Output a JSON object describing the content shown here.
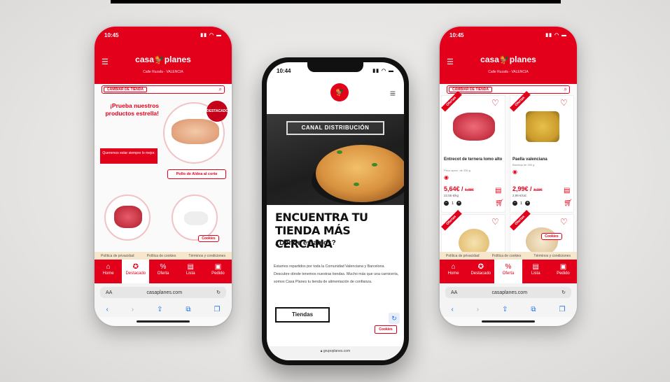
{
  "left": {
    "time": "10:45",
    "logo": "casa🐓planes",
    "location": "Calle Ruzafa - VALENCIA",
    "change_store": "CAMBIAR DE TIENDA",
    "promo_title": "¡Prueba nuestros productos estrella!",
    "promo_cta": "Queremos estar siempre lo mejor.",
    "badge": "DESTACADO",
    "product_button": "Pollo de Aldea al corte",
    "cookies": "Cookies",
    "cookie_links": [
      "Política de privacidad",
      "Política de cookies",
      "Términos y condiciones"
    ],
    "tabs": [
      "Home",
      "Destacado",
      "Oferta",
      "Lista",
      "Pedido"
    ],
    "url": "casaplanes.com",
    "aa": "AA"
  },
  "middle": {
    "time": "10:44",
    "canal": "CANAL DISTRIBUCIÓN",
    "heading": "ENCUENTRA TU TIENDA MÁS CERCANA",
    "subheading": "¿Dónde estamos?",
    "paragraph": "Estamos repartidos por toda la Comunidad Valenciana y Barcelona. Descubre dónde tenemos nuestras tiendas. Mucho más que una carnicería, somos Casa Planes tu tienda de alimentación de confianza.",
    "button": "Tiendas",
    "cookies": "Cookies",
    "url": "grupoplanes.com"
  },
  "right": {
    "time": "10:45",
    "logo": "casa🐓planes",
    "location": "Calle Ruzafa - VALENCIA",
    "change_store": "CAMBIAR DE TIENDA",
    "ribbon": "Ofertas",
    "products": [
      {
        "name": "Entrecot de ternera lomo alto",
        "sub": "Peso aprox. de 250 g",
        "price": "5,64€ /",
        "old": "6,08€",
        "per": "22,55 €/kg",
        "qty": "1"
      },
      {
        "name": "Paella valenciana",
        "sub": "Bandeja de 300 g",
        "price": "2,99€ /",
        "old": "3,23€",
        "per": "2,99 €/Ud.",
        "qty": "1"
      }
    ],
    "cookies": "Cookies",
    "cookie_links": [
      "Política de privacidad",
      "Política de cookies",
      "Términos y condiciones"
    ],
    "tabs": [
      "Home",
      "Destacado",
      "Oferta",
      "Lista",
      "Pedido"
    ],
    "url": "casaplanes.com",
    "aa": "AA"
  },
  "colors": {
    "brand_red": "#e3001b"
  }
}
